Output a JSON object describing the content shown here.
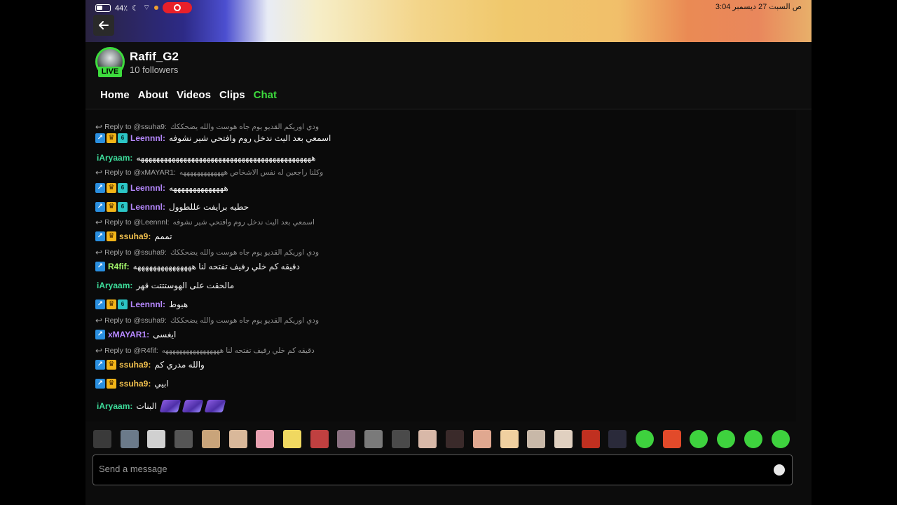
{
  "status_bar": {
    "battery": "44٪",
    "time": "3:04",
    "date": "ص   السبت 27 ديسمبر"
  },
  "channel": {
    "name": "Rafif_G2",
    "followers": "10 followers",
    "live_label": "LIVE"
  },
  "tabs": [
    {
      "label": "Home"
    },
    {
      "label": "About"
    },
    {
      "label": "Videos"
    },
    {
      "label": "Clips"
    },
    {
      "label": "Chat",
      "active": true
    }
  ],
  "chat": {
    "messages": [
      {
        "type": "reply",
        "prefix": "Reply to @ssuha9:",
        "text": "ودي اوريكم القديو يوم جاه هوست والله يضحككك"
      },
      {
        "type": "message",
        "user": "Leennnl:",
        "user_color": "#b688ff",
        "badges": [
          "blue",
          "crown",
          "teal"
        ],
        "text": "اسمعي بعد اليث ندخل روم وافتحي شير نشوفه"
      },
      {
        "type": "message",
        "user": "iAryaam:",
        "user_color": "#3ddc9a",
        "badges": [],
        "text": "هههههههههههههههههههههههههههههههههههههههههههههه"
      },
      {
        "type": "reply",
        "prefix": "Reply to @xMAYAR1:",
        "text": "وكلنا راجعين له نفس الاشخاص هههههههههههههه"
      },
      {
        "type": "message",
        "user": "Leennnl:",
        "user_color": "#b688ff",
        "badges": [
          "blue",
          "crown",
          "teal"
        ],
        "text": "ههههههههههههههه"
      },
      {
        "type": "message",
        "user": "Leennnl:",
        "user_color": "#b688ff",
        "badges": [
          "blue",
          "crown",
          "teal"
        ],
        "text": "حطيه برايفت عللطوول"
      },
      {
        "type": "reply",
        "prefix": "Reply to @Leennnl:",
        "text": "اسمعي بعد اليث ندخل روم وافتحي شير نشوفه"
      },
      {
        "type": "message",
        "user": "ssuha9:",
        "user_color": "#f2c14e",
        "badges": [
          "blue",
          "crown"
        ],
        "text": "تممم"
      },
      {
        "type": "reply",
        "prefix": "Reply to @ssuha9:",
        "text": "ودي اوريكم القديو يوم جاه هوست والله يضحككك"
      },
      {
        "type": "message",
        "user": "R4fif:",
        "user_color": "#a3f56b",
        "badges": [
          "blue"
        ],
        "text": "دقيقه كم خلي رفيف تفتحه لنا هههههههههههههههه"
      },
      {
        "type": "message",
        "user": "iAryaam:",
        "user_color": "#3ddc9a",
        "badges": [],
        "text": "مالحقت على الهوستتتت قهر"
      },
      {
        "type": "message",
        "user": "Leennnl:",
        "user_color": "#b688ff",
        "badges": [
          "blue",
          "crown",
          "teal"
        ],
        "text": "هبوط"
      },
      {
        "type": "reply",
        "prefix": "Reply to @ssuha9:",
        "text": "ودي اوريكم القديو يوم جاه هوست والله يضحككك"
      },
      {
        "type": "message",
        "user": "xMAYAR1:",
        "user_color": "#b688ff",
        "badges": [
          "blue"
        ],
        "text": "ايغسى"
      },
      {
        "type": "reply",
        "prefix": "Reply to @R4fif:",
        "text": "دقيقه كم خلي رفيف تفتحه لنا هههههههههههههههههه"
      },
      {
        "type": "message",
        "user": "ssuha9:",
        "user_color": "#f2c14e",
        "badges": [
          "blue",
          "crown"
        ],
        "text": "والله مدري كم"
      },
      {
        "type": "message",
        "user": "ssuha9:",
        "user_color": "#f2c14e",
        "badges": [
          "blue",
          "crown"
        ],
        "text": "ابيي"
      },
      {
        "type": "message",
        "user": "iAryaam:",
        "user_color": "#3ddc9a",
        "badges": [],
        "text": "البنات",
        "gifts": 3
      }
    ]
  },
  "emotes": [
    "emote-1",
    "emote-2",
    "emote-3",
    "emote-4",
    "emote-5",
    "emote-6",
    "emote-7",
    "emote-8",
    "emote-9",
    "emote-10",
    "emote-11",
    "emote-12",
    "emote-13",
    "emote-14",
    "emote-15",
    "emote-16",
    "emote-17",
    "emote-18",
    "emote-19",
    "emote-20",
    "emote-21",
    "emote-22",
    "emote-23",
    "emote-24",
    "emote-25",
    "emote-26"
  ],
  "input": {
    "placeholder": "Send a message"
  },
  "colors": {
    "accent": "#3ddc3d",
    "background": "#0c0c0c"
  }
}
